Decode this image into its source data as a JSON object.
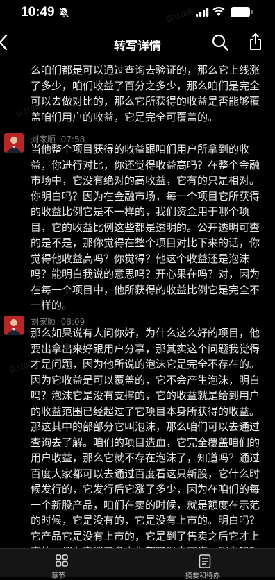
{
  "status_bar": {
    "time": "10:49"
  },
  "nav": {
    "title": "转写详情"
  },
  "transcript": {
    "top_text": "么咱们都是可以通过查询去验证的，那么它上线涨了多少，咱们收益了百分之多少，那么咱们是完全可以去做对比的，那么它所获得的收益是否能够覆盖咱们用户的收益，它是完全可覆盖的。",
    "messages": [
      {
        "speaker": "刘家顺",
        "time": "07:58",
        "text": "当他整个项目获得的收益跟咱们用户所拿到的收益，你进行对比，你还觉得收益高吗？在整个金融市场中，它没有绝对的高收益，它有的只是相对。你明白吗？因为在金融市场，每一个项目它所获得的收益比例它是不一样的，我们资金用于哪个项目，它的收益比例这些都是透明的。公开透明可查的是不是，那你觉得在整个项目对比下来的话，你觉得他收益高吗？你觉得？他这个收益还是泡沫吗？能明白我说的意思吗？开心果在吗？对，因为在每一个项目中，他所获得的收益比例它是完全不一样的。"
      },
      {
        "speaker": "刘家顺",
        "time": "08:09",
        "text": "那么如果说有人问你好，为什么这么好的项目，他要出拿出来好跟用户分享，那其实这个问题我觉得才是问题，因为他所说的泡沫它是完全不存在的。因为它收益是可以覆盖的，它不会产生泡沫，明白吗？泡沫它是没有支撑的，它的收益就是给到用户的收益范围已经超过了它项目本身所获得的收益。那这其中的部部分它叫泡沫，那么咱们可以去通过查询去了解。咱们的项目造血，它完全覆盖咱们的用户收益，那么它就不存在泡沫了，知道吗？通过百度大家都可以去通过百度看这只新股，它什么时候发行的，它发行后它涨了多少，因为在咱们的每一个新股产品，咱们在卖的时候，就是额度在示范的时候，它是没有的，它是没有上市的。明白吗？它产品它是没有上市的，它是到了售卖之后它才上市的，那么它涨了多少你都可以去查询。明白吗？你只要把它直接来查询这支股票，你就明白了。因为每"
      }
    ]
  },
  "watermark": {
    "text": "仅110网"
  },
  "bottom_bar": {
    "chapters_label": "章节",
    "todo_label": "摘要和待办"
  },
  "icons": [
    "bell-mute-icon",
    "signal-icon",
    "wifi-icon",
    "battery-icon",
    "back-chevron-icon",
    "search-icon",
    "share-icon",
    "avatar",
    "chapters-grid-icon",
    "todo-document-icon"
  ],
  "colors": {
    "background": "#000000",
    "text": "#ececec",
    "meta_text": "#7c7c7c",
    "bottom_bar": "#151515"
  }
}
